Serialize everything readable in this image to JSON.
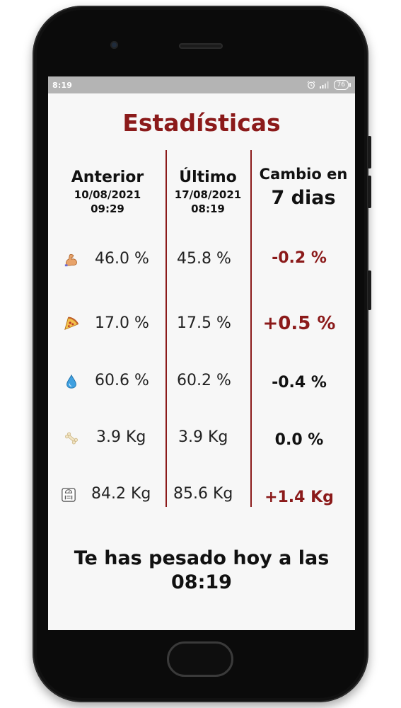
{
  "status_bar": {
    "time": "8:19",
    "battery": "76"
  },
  "title": "Estadísticas",
  "columns": {
    "previous": {
      "label": "Anterior",
      "date": "10/08/2021",
      "time": "09:29"
    },
    "latest": {
      "label": "Último",
      "date": "17/08/2021",
      "time": "08:19"
    },
    "change": {
      "label_line1": "Cambio en",
      "label_line2": "7 dias"
    }
  },
  "rows": [
    {
      "icon": "flexed-biceps-icon",
      "previous": "46.0 %",
      "latest": "45.8 %",
      "change": "-0.2 %"
    },
    {
      "icon": "pizza-slice-icon",
      "previous": "17.0 %",
      "latest": "17.5 %",
      "change": "+0.5 %"
    },
    {
      "icon": "water-drop-icon",
      "previous": "60.6 %",
      "latest": "60.2 %",
      "change": "-0.4 %"
    },
    {
      "icon": "bone-icon",
      "previous": "3.9 Kg",
      "latest": "3.9 Kg",
      "change": "0.0 %"
    },
    {
      "icon": "weight-scale-icon",
      "previous": "84.2 Kg",
      "latest": "85.6 Kg",
      "change": "+1.4 Kg"
    }
  ],
  "footer": {
    "line1": "Te has pesado hoy a las",
    "line2": "08:19"
  },
  "colors": {
    "accent": "#8b1a1a",
    "screen_bg": "#f7f7f7",
    "status_bar": "#b4b4b4"
  }
}
